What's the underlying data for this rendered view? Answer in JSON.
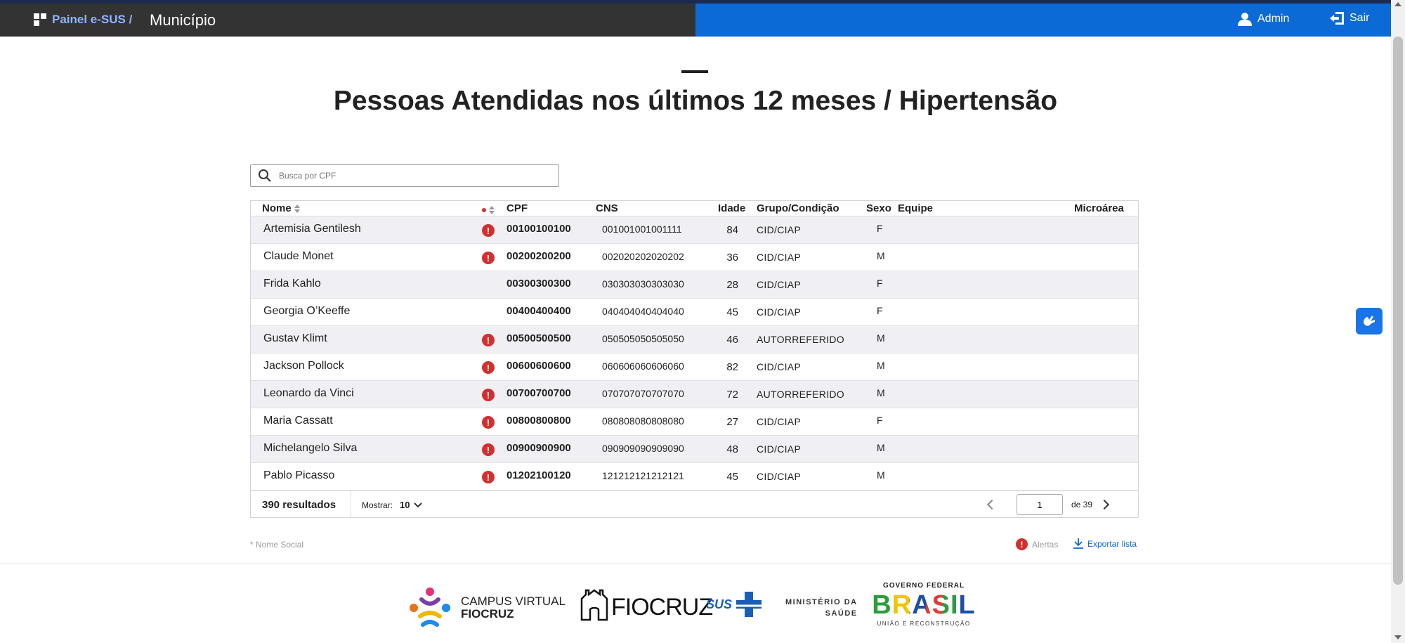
{
  "header": {
    "brand": "Painel e-SUS /",
    "context": "Município",
    "admin_label": "Admin",
    "logout_label": "Sair"
  },
  "page": {
    "title": "Pessoas Atendidas nos últimos 12 meses / Hipertensão"
  },
  "search": {
    "placeholder": "Busca por CPF",
    "value": ""
  },
  "table": {
    "columns": {
      "nome": "Nome",
      "cpf": "CPF",
      "cns": "CNS",
      "idade": "Idade",
      "grupo": "Grupo/Condição",
      "sexo": "Sexo",
      "equipe": "Equipe",
      "microarea": "Microárea"
    },
    "rows": [
      {
        "nome": "Artemisia Gentilesh",
        "alert": "!",
        "cpf": "00100100100",
        "cns": "001001001001111",
        "idade": "84",
        "grupo": "CID/CIAP",
        "sexo": "F"
      },
      {
        "nome": "Claude Monet",
        "alert": "!",
        "cpf": "00200200200",
        "cns": "002020202020202",
        "idade": "36",
        "grupo": "CID/CIAP",
        "sexo": "M"
      },
      {
        "nome": "Frida Kahlo",
        "alert": "",
        "cpf": "00300300300",
        "cns": "030303030303030",
        "idade": "28",
        "grupo": "CID/CIAP",
        "sexo": "F"
      },
      {
        "nome": "Georgia O’Keeffe",
        "alert": "",
        "cpf": "00400400400",
        "cns": "040404040404040",
        "idade": "45",
        "grupo": "CID/CIAP",
        "sexo": "F"
      },
      {
        "nome": "Gustav Klimt",
        "alert": "!",
        "cpf": "00500500500",
        "cns": "050505050505050",
        "idade": "46",
        "grupo": "AUTORREFERIDO",
        "sexo": "M"
      },
      {
        "nome": "Jackson Pollock",
        "alert": "!",
        "cpf": "00600600600",
        "cns": "060606060606060",
        "idade": "82",
        "grupo": "CID/CIAP",
        "sexo": "M"
      },
      {
        "nome": "Leonardo da Vinci",
        "alert": "!",
        "cpf": "00700700700",
        "cns": "070707070707070",
        "idade": "72",
        "grupo": "AUTORREFERIDO",
        "sexo": "M"
      },
      {
        "nome": "Maria Cassatt",
        "alert": "!",
        "cpf": "00800800800",
        "cns": "080808080808080",
        "idade": "27",
        "grupo": "CID/CIAP",
        "sexo": "F"
      },
      {
        "nome": "Michelangelo Silva",
        "alert": "!",
        "cpf": "00900900900",
        "cns": "090909090909090",
        "idade": "48",
        "grupo": "CID/CIAP",
        "sexo": "M"
      },
      {
        "nome": "Pablo Picasso",
        "alert": "!",
        "cpf": "01202100120",
        "cns": "121212121212121",
        "idade": "45",
        "grupo": "CID/CIAP",
        "sexo": "M"
      }
    ],
    "footer": {
      "results": "390 resultados",
      "show_label": "Mostrar:",
      "page_size": "10",
      "current_page": "1",
      "total_pages": "de 39"
    }
  },
  "notes": {
    "nome_social": "* Nome Social",
    "alertas": "Alertas",
    "exportar": "Exportar lista"
  },
  "footer_logos": {
    "campus_line1": "CAMPUS VIRTUAL",
    "campus_line2": "FIOCRUZ",
    "fiocruz": "FIOCRUZ",
    "sus": "SUS",
    "ministerio_line1": "MINISTÉRIO DA",
    "ministerio_line2": "SAÚDE",
    "governo": "GOVERNO FEDERAL",
    "brasil": "BRASIL",
    "uniao": "UNIÃO E RECONSTRUÇÃO"
  },
  "colors": {
    "header_dark": "#333333",
    "header_blue": "#0b6ad6",
    "alert_red": "#d32f2f",
    "link_blue": "#0b6ad6"
  }
}
